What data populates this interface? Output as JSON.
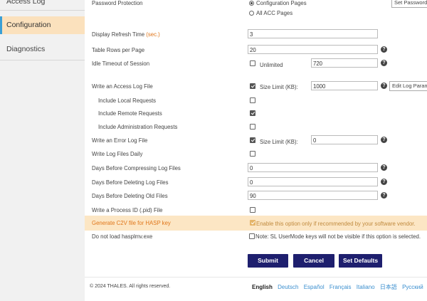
{
  "sidebar": {
    "items": [
      {
        "label": "Access Log"
      },
      {
        "label": "Configuration"
      },
      {
        "label": "Diagnostics"
      }
    ]
  },
  "password": {
    "label": "Password Protection",
    "option1": "Configuration Pages",
    "option2": "All ACC Pages",
    "set_button": "Set Password"
  },
  "refresh": {
    "label": "Display Refresh Time",
    "unit": "(sec.)",
    "value": "3"
  },
  "table_rows": {
    "label": "Table Rows per Page",
    "value": "20"
  },
  "idle": {
    "label": "Idle Timeout of Session",
    "unlimited": "Unlimited",
    "value": "720"
  },
  "access_log": {
    "label": "Write an Access Log File",
    "size_label": "Size Limit (KB):",
    "value": "1000",
    "edit_button": "Edit Log Parameters"
  },
  "local": {
    "label": "Include Local Requests"
  },
  "remote": {
    "label": "Include Remote Requests"
  },
  "admin": {
    "label": "Include Administration Requests"
  },
  "error_log": {
    "label": "Write an Error Log File",
    "size_label": "Size Limit (KB):",
    "value": "0"
  },
  "daily": {
    "label": "Write Log Files Daily"
  },
  "compress": {
    "label": "Days Before Compressing Log Files",
    "value": "0"
  },
  "delete_log": {
    "label": "Days Before Deleting Log Files",
    "value": "0"
  },
  "delete_old": {
    "label": "Days Before Deleting Old Files",
    "value": "90"
  },
  "pid": {
    "label": "Write a Process ID (.pid) File"
  },
  "c2v": {
    "label": "Generate C2V file for HASP key",
    "note": "Enable this option only if recommended by your software vendor."
  },
  "hasplmv": {
    "label": "Do not load hasplmv.exe",
    "note": "Note: SL UserMode keys will not be visible if this option is selected."
  },
  "buttons": {
    "submit": "Submit",
    "cancel": "Cancel",
    "defaults": "Set Defaults"
  },
  "footer": {
    "copyright": "© 2024 THALES. All rights reserved.",
    "languages": [
      "English",
      "Deutsch",
      "Español",
      "Français",
      "Italiano",
      "日本語",
      "Русский"
    ]
  },
  "help_glyph": "?",
  "colors": {
    "accent": "#1e1f6e",
    "highlight_bg": "#fce6c4",
    "highlight_text": "#e0761a",
    "sidebar_active": "#fbe1bd",
    "link": "#3b8fcf"
  }
}
